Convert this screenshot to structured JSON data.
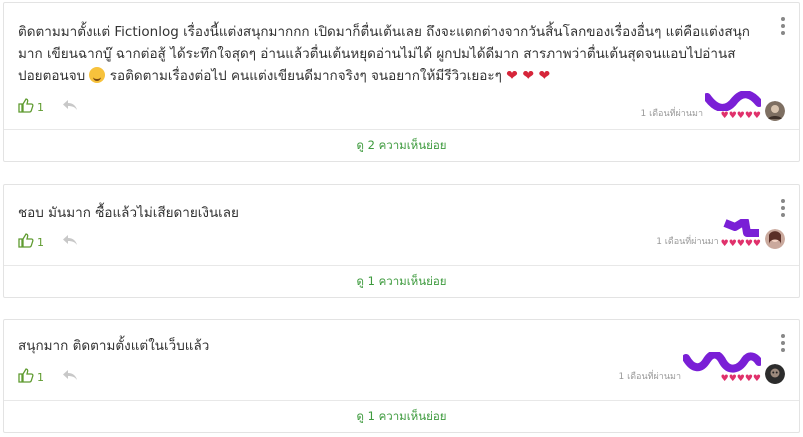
{
  "comments": [
    {
      "text_a": "ติดตามมาตั้งแต่ Fictionlog เรื่องนี้แต่งสนุกมากกก เปิดมาก็ตื่นเต้นเลย ถึงจะแตกต่างจากวันสิ้นโลกของเรื่องอื่นๆ แต่คือแต่งสนุกมาก เขียนฉากบู๊ ฉากต่อสู้ ได้ระทึกใจสุดๆ อ่านแล้วตื่นเต้นหยุดอ่านไม่ได้ ผูกปมได้ดีมาก สารภาพว่าตื่นเต้นสุดจนแอบไปอ่านสปอยตอนจบ",
      "text_b": "รอติดตามเรื่องต่อไป คนแต่งเขียนดีมากจริงๆ จนอยากให้มีรีวิวเยอะๆ",
      "inline_hearts": "❤ ❤ ❤",
      "likes": "1",
      "time": "1 เดือนที่ผ่านมา",
      "rating_hearts": "♥♥♥♥♥",
      "replies": "ดู 2 ความเห็นย่อย"
    },
    {
      "text": "ชอบ มันมาก ซื้อแล้วไม่เสียดายเงินเลย",
      "likes": "1",
      "time": "1 เดือนที่ผ่านมา",
      "rating_hearts": "♥♥♥♥♥",
      "replies": "ดู 1 ความเห็นย่อย"
    },
    {
      "text": "สนุกมาก ติดตามตั้งแต่ในเว็บแล้ว",
      "likes": "1",
      "time": "1 เดือนที่ผ่านมา",
      "rating_hearts": "♥♥♥♥♥",
      "replies": "ดู 1 ความเห็นย่อย"
    }
  ],
  "colors": {
    "accent_green": "#3d9a3d",
    "like_green": "#5f9b30",
    "heart_pink": "#e0316b",
    "redaction_purple": "#7a1fd6"
  },
  "icons": {
    "like": "thumbs-up-icon",
    "reply": "reply-arrow-icon",
    "menu": "vertical-dots-icon",
    "emoji": "laughing-emoji-icon"
  }
}
